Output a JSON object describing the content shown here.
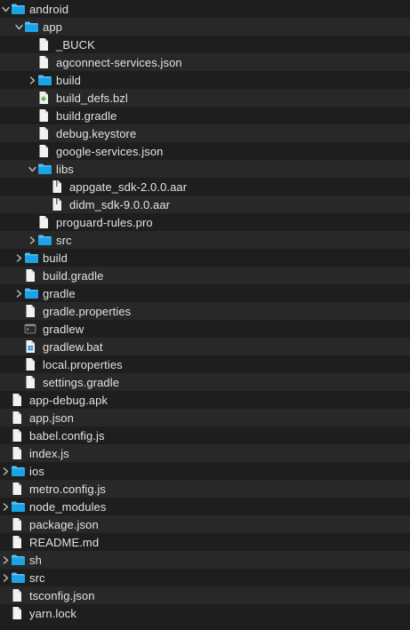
{
  "colors": {
    "folder": "#1aa3e8",
    "folder_tab": "#5bc0f2",
    "file_page": "#f2f2f2",
    "row_alt": "#282828",
    "row_base": "#1e1e1e",
    "text": "#e2e2e2",
    "chevron": "#bfbfbf"
  },
  "items": [
    {
      "label": "android",
      "kind": "folder",
      "depth": 0,
      "disclosure": "expanded",
      "icon": "folder-icon"
    },
    {
      "label": "app",
      "kind": "folder",
      "depth": 1,
      "disclosure": "expanded",
      "icon": "folder-icon"
    },
    {
      "label": "_BUCK",
      "kind": "file",
      "depth": 2,
      "disclosure": "none",
      "icon": "document-icon"
    },
    {
      "label": "agconnect-services.json",
      "kind": "file",
      "depth": 2,
      "disclosure": "none",
      "icon": "document-icon"
    },
    {
      "label": "build",
      "kind": "folder",
      "depth": 2,
      "disclosure": "collapsed",
      "icon": "folder-icon"
    },
    {
      "label": "build_defs.bzl",
      "kind": "file",
      "depth": 2,
      "disclosure": "none",
      "icon": "bazel-file-icon"
    },
    {
      "label": "build.gradle",
      "kind": "file",
      "depth": 2,
      "disclosure": "none",
      "icon": "document-icon"
    },
    {
      "label": "debug.keystore",
      "kind": "file",
      "depth": 2,
      "disclosure": "none",
      "icon": "document-icon"
    },
    {
      "label": "google-services.json",
      "kind": "file",
      "depth": 2,
      "disclosure": "none",
      "icon": "document-icon"
    },
    {
      "label": "libs",
      "kind": "folder",
      "depth": 2,
      "disclosure": "expanded",
      "icon": "folder-icon"
    },
    {
      "label": "appgate_sdk-2.0.0.aar",
      "kind": "file",
      "depth": 3,
      "disclosure": "none",
      "icon": "archive-file-icon"
    },
    {
      "label": "didm_sdk-9.0.0.aar",
      "kind": "file",
      "depth": 3,
      "disclosure": "none",
      "icon": "archive-file-icon"
    },
    {
      "label": "proguard-rules.pro",
      "kind": "file",
      "depth": 2,
      "disclosure": "none",
      "icon": "document-icon"
    },
    {
      "label": "src",
      "kind": "folder",
      "depth": 2,
      "disclosure": "collapsed",
      "icon": "folder-icon"
    },
    {
      "label": "build",
      "kind": "folder",
      "depth": 1,
      "disclosure": "collapsed",
      "icon": "folder-icon"
    },
    {
      "label": "build.gradle",
      "kind": "file",
      "depth": 1,
      "disclosure": "none",
      "icon": "document-icon"
    },
    {
      "label": "gradle",
      "kind": "folder",
      "depth": 1,
      "disclosure": "collapsed",
      "icon": "folder-icon"
    },
    {
      "label": "gradle.properties",
      "kind": "file",
      "depth": 1,
      "disclosure": "none",
      "icon": "document-icon"
    },
    {
      "label": "gradlew",
      "kind": "file",
      "depth": 1,
      "disclosure": "none",
      "icon": "terminal-file-icon"
    },
    {
      "label": "gradlew.bat",
      "kind": "file",
      "depth": 1,
      "disclosure": "none",
      "icon": "windows-batch-file-icon"
    },
    {
      "label": "local.properties",
      "kind": "file",
      "depth": 1,
      "disclosure": "none",
      "icon": "document-icon"
    },
    {
      "label": "settings.gradle",
      "kind": "file",
      "depth": 1,
      "disclosure": "none",
      "icon": "document-icon"
    },
    {
      "label": "app-debug.apk",
      "kind": "file",
      "depth": 0,
      "disclosure": "none",
      "icon": "document-icon"
    },
    {
      "label": "app.json",
      "kind": "file",
      "depth": 0,
      "disclosure": "none",
      "icon": "document-icon"
    },
    {
      "label": "babel.config.js",
      "kind": "file",
      "depth": 0,
      "disclosure": "none",
      "icon": "document-icon"
    },
    {
      "label": "index.js",
      "kind": "file",
      "depth": 0,
      "disclosure": "none",
      "icon": "document-icon"
    },
    {
      "label": "ios",
      "kind": "folder",
      "depth": 0,
      "disclosure": "collapsed",
      "icon": "folder-icon"
    },
    {
      "label": "metro.config.js",
      "kind": "file",
      "depth": 0,
      "disclosure": "none",
      "icon": "document-icon"
    },
    {
      "label": "node_modules",
      "kind": "folder",
      "depth": 0,
      "disclosure": "collapsed",
      "icon": "folder-icon"
    },
    {
      "label": "package.json",
      "kind": "file",
      "depth": 0,
      "disclosure": "none",
      "icon": "document-icon"
    },
    {
      "label": "README.md",
      "kind": "file",
      "depth": 0,
      "disclosure": "none",
      "icon": "document-icon"
    },
    {
      "label": "sh",
      "kind": "folder",
      "depth": 0,
      "disclosure": "collapsed",
      "icon": "folder-icon"
    },
    {
      "label": "src",
      "kind": "folder",
      "depth": 0,
      "disclosure": "collapsed",
      "icon": "folder-icon"
    },
    {
      "label": "tsconfig.json",
      "kind": "file",
      "depth": 0,
      "disclosure": "none",
      "icon": "document-icon"
    },
    {
      "label": "yarn.lock",
      "kind": "file",
      "depth": 0,
      "disclosure": "none",
      "icon": "document-icon"
    }
  ]
}
